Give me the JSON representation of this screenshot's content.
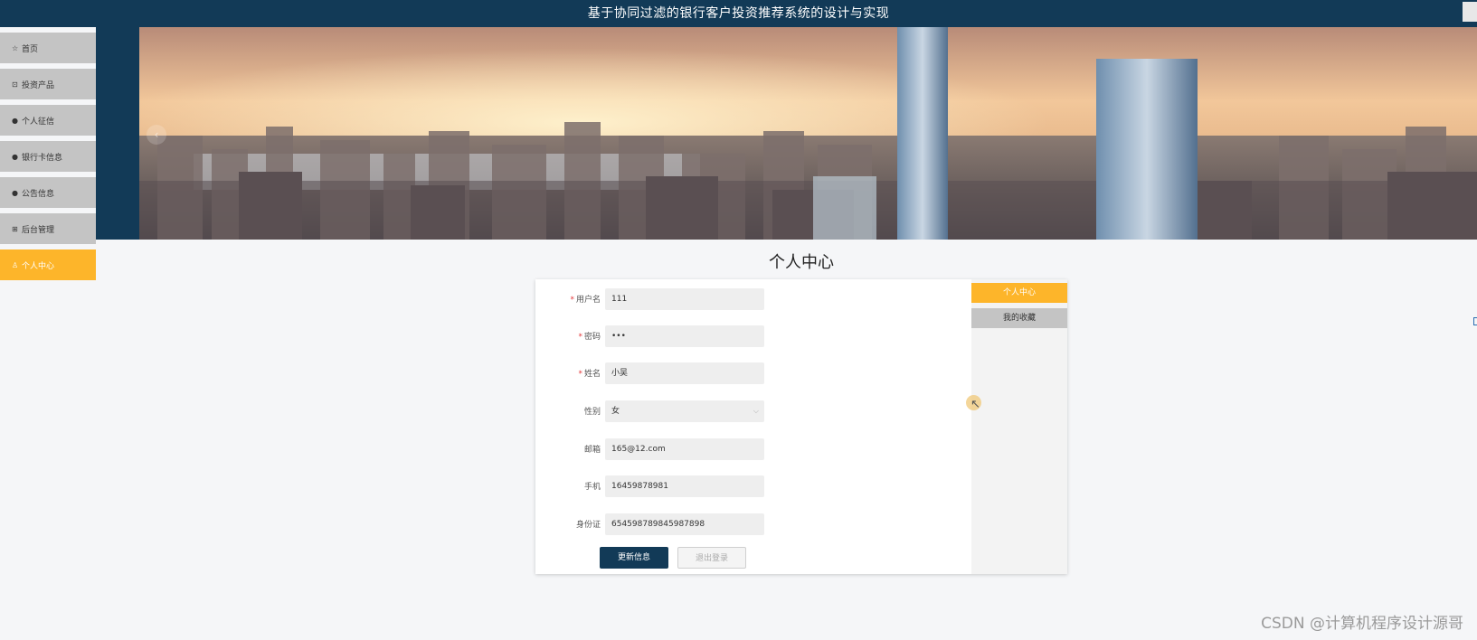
{
  "header": {
    "title": "基于协同过滤的银行客户投资推荐系统的设计与实现"
  },
  "sidebar": {
    "items": [
      {
        "label": "首页",
        "icon": "star-icon",
        "glyph": "☆"
      },
      {
        "label": "投资产品",
        "icon": "bag-icon",
        "glyph": "⊡"
      },
      {
        "label": "个人征信",
        "icon": "info-icon",
        "glyph": "●"
      },
      {
        "label": "银行卡信息",
        "icon": "help-icon",
        "glyph": "●"
      },
      {
        "label": "公告信息",
        "icon": "notice-icon",
        "glyph": "●"
      },
      {
        "label": "后台管理",
        "icon": "gift-icon",
        "glyph": "⊞"
      },
      {
        "label": "个人中心",
        "icon": "user-icon",
        "glyph": "♙",
        "active": true
      }
    ]
  },
  "banner": {
    "prev_glyph": "‹"
  },
  "page": {
    "title": "个人中心"
  },
  "form": {
    "fields": [
      {
        "label": "用户名",
        "required": true,
        "value": "111",
        "type": "text"
      },
      {
        "label": "密码",
        "required": true,
        "value": "•••",
        "type": "password"
      },
      {
        "label": "姓名",
        "required": true,
        "value": "小吴",
        "type": "text"
      },
      {
        "label": "性别",
        "required": false,
        "value": "女",
        "type": "select"
      },
      {
        "label": "邮箱",
        "required": false,
        "value": "165@12.com",
        "type": "text"
      },
      {
        "label": "手机",
        "required": false,
        "value": "16459878981",
        "type": "text"
      },
      {
        "label": "身份证",
        "required": false,
        "value": "654598789845987898",
        "type": "text"
      }
    ],
    "required_mark": "*",
    "select_caret": "⌵",
    "update_label": "更新信息",
    "logout_label": "退出登录"
  },
  "tabs": {
    "items": [
      {
        "label": "个人中心",
        "active": true
      },
      {
        "label": "我的收藏",
        "active": false
      }
    ]
  },
  "cursor": {
    "glyph": "↖"
  },
  "watermark": {
    "text": "CSDN @计算机程序设计源哥"
  },
  "colors": {
    "navy": "#123a57",
    "accent": "#fdb52a",
    "nav_gray": "#c4c4c4"
  }
}
